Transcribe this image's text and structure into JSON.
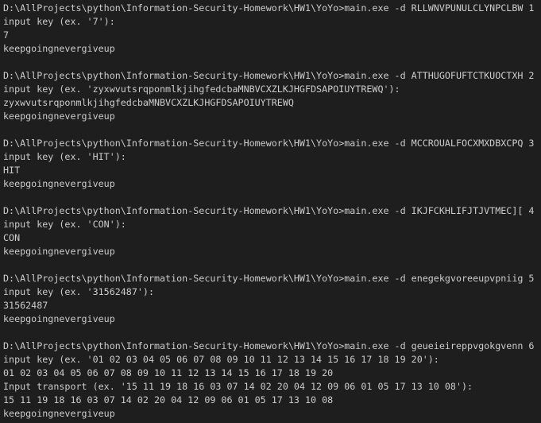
{
  "terminal": {
    "lines": [
      "D:\\AllProjects\\python\\Information-Security-Homework\\HW1\\YoYo>main.exe -d RLLWNVPUNULCLYNPCLBW 1",
      "input key (ex. '7'):",
      "7",
      "keepgoingnevergiveup",
      "",
      "D:\\AllProjects\\python\\Information-Security-Homework\\HW1\\YoYo>main.exe -d ATTHUGOFUFTCTKUOCTXH 2",
      "input key (ex. 'zyxwvutsrqponmlkjihgfedcbaMNBVCXZLKJHGFDSAPOIUYTREWQ'):",
      "zyxwvutsrqponmlkjihgfedcbaMNBVCXZLKJHGFDSAPOIUYTREWQ",
      "keepgoingnevergiveup",
      "",
      "D:\\AllProjects\\python\\Information-Security-Homework\\HW1\\YoYo>main.exe -d MCCROUALFOCXMXDBXCPQ 3",
      "input key (ex. 'HIT'):",
      "HIT",
      "keepgoingnevergiveup",
      "",
      "D:\\AllProjects\\python\\Information-Security-Homework\\HW1\\YoYo>main.exe -d IKJFCKHLIFJTJVTMEC][ 4",
      "input key (ex. 'CON'):",
      "CON",
      "keepgoingnevergiveup",
      "",
      "D:\\AllProjects\\python\\Information-Security-Homework\\HW1\\YoYo>main.exe -d enegekgvoreeupvpniig 5",
      "input key (ex. '31562487'):",
      "31562487",
      "keepgoingnevergiveup",
      "",
      "D:\\AllProjects\\python\\Information-Security-Homework\\HW1\\YoYo>main.exe -d geueieireppvgokgvenn 6",
      "input key (ex. '01 02 03 04 05 06 07 08 09 10 11 12 13 14 15 16 17 18 19 20'):",
      "01 02 03 04 05 06 07 08 09 10 11 12 13 14 15 16 17 18 19 20",
      "Input transport (ex. '15 11 19 18 16 03 07 14 02 20 04 12 09 06 01 05 17 13 10 08'):",
      "15 11 19 18 16 03 07 14 02 20 04 12 09 06 01 05 17 13 10 08",
      "keepgoingnevergiveup"
    ]
  }
}
